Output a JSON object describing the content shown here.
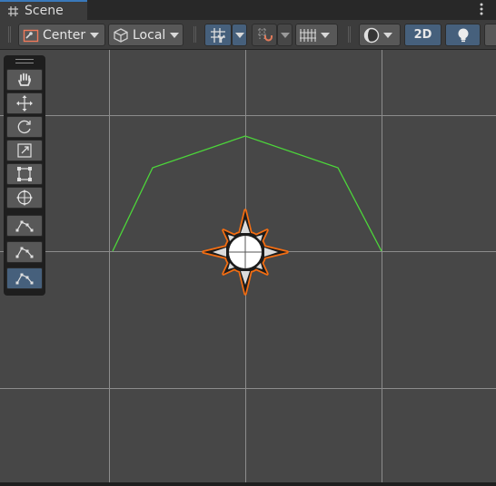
{
  "tab": {
    "title": "Scene",
    "icon": "hash-grid-icon"
  },
  "toolbar": {
    "pivot_mode": "Center",
    "pivot_rotation": "Local",
    "grid_snap_icon": "grid-snap-icon",
    "increment_snap_icon": "snap-magnet-icon",
    "grid_visibility_icon": "grid-visibility-icon",
    "shading_icon": "shading-mode-icon",
    "mode_2d": "2D",
    "lighting_icon": "lightbulb-icon",
    "colors": {
      "active": "#46607c",
      "button": "#585858"
    }
  },
  "tools": {
    "items": [
      {
        "name": "hand-tool",
        "icon": "hand-icon",
        "active": false
      },
      {
        "name": "move-tool",
        "icon": "move-arrows-icon",
        "active": false
      },
      {
        "name": "rotate-tool",
        "icon": "rotate-icon",
        "active": false
      },
      {
        "name": "scale-tool",
        "icon": "scale-icon",
        "active": false
      },
      {
        "name": "rect-tool",
        "icon": "rect-transform-icon",
        "active": false
      },
      {
        "name": "transform-tool",
        "icon": "transform-icon",
        "active": false
      },
      {
        "name": "custom-tool-1",
        "icon": "path-edit-icon",
        "active": false
      },
      {
        "name": "custom-tool-2",
        "icon": "path-edit-icon",
        "active": false
      },
      {
        "name": "custom-tool-3",
        "icon": "path-edit-icon",
        "active": true
      }
    ]
  },
  "scene": {
    "background": "#474747",
    "grid_color": "#8c8c8c",
    "path_color": "#4cd63a",
    "selection_outline_color": "#f36d12",
    "gizmo_icon": "light-sun-gizmo-icon"
  }
}
